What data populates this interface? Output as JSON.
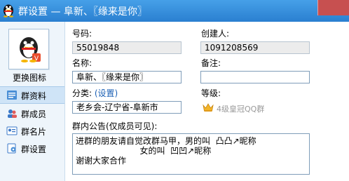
{
  "window": {
    "title": "群设置 — 阜新、〖缘来是你〗"
  },
  "sidebar": {
    "change_icon_label": "更换图标",
    "items": [
      {
        "label": "群资料",
        "active": true,
        "icon": "group-info-icon"
      },
      {
        "label": "群成员",
        "active": false,
        "icon": "group-members-icon"
      },
      {
        "label": "群名片",
        "active": false,
        "icon": "group-card-icon"
      },
      {
        "label": "群设置",
        "active": false,
        "icon": "group-settings-icon"
      }
    ]
  },
  "form": {
    "number_label": "号码:",
    "number_value": "55019848",
    "creator_label": "创建人:",
    "creator_value": "1091208569",
    "name_label": "名称:",
    "name_value": "阜新、〖缘来是你〗",
    "remark_label": "备注:",
    "remark_value": "",
    "category_label": "分类:",
    "category_link": "(设置)",
    "category_value": "老乡会-辽宁省-阜新市",
    "level_label": "等级:",
    "level_value": "4级皇冠QQ群",
    "notice_label": "群内公告(仅成员可见):",
    "notice_lines": [
      "进群的朋友请自觉改群马甲，男的叫  凸凸↗昵称",
      "                        女的叫  凹凹↗昵称",
      "谢谢大家合作"
    ]
  },
  "colors": {
    "titlebar": "#2a7fd0",
    "sidebar_bg": "#eef5fb",
    "active_item": "#cfe4f7",
    "link": "#1a5fb4"
  }
}
